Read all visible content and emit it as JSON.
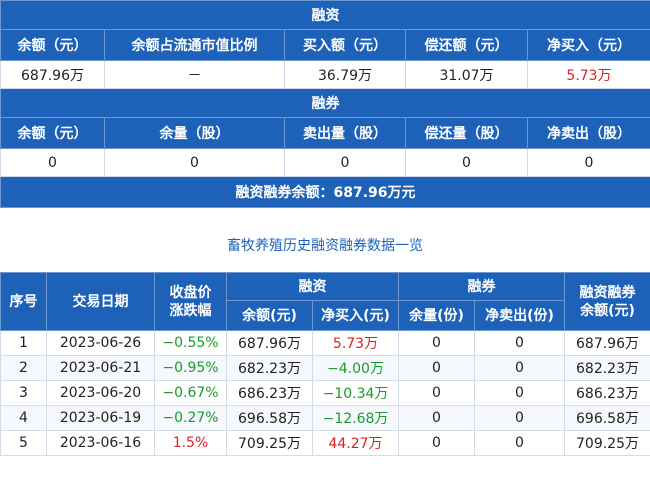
{
  "financing": {
    "section_title": "融资",
    "headers": [
      "余额（元）",
      "余额占流通市值比例",
      "买入额（元）",
      "偿还额（元）",
      "净买入（元）"
    ],
    "values": [
      "687.96万",
      "－",
      "36.79万",
      "31.07万",
      "5.73万"
    ]
  },
  "securities_lending": {
    "section_title": "融券",
    "headers": [
      "余额（元）",
      "余量（股）",
      "卖出量（股）",
      "偿还量（股）",
      "净卖出（股）"
    ],
    "values": [
      "0",
      "0",
      "0",
      "0",
      "0"
    ]
  },
  "total": {
    "label": "融资融券余额：687.96万元"
  },
  "history": {
    "caption": "畜牧养殖历史融资融券数据一览",
    "headers": {
      "index": "序号",
      "date": "交易日期",
      "change": "收盘价涨跌幅",
      "financing_group": "融资",
      "securities_group": "融券",
      "total": "融资融券余额(元)",
      "fin_balance": "余额(元)",
      "fin_net_buy": "净买入(元)",
      "sec_volume": "余量(份)",
      "sec_net_sell": "净卖出(份)"
    },
    "rows": [
      {
        "index": "1",
        "date": "2023-06-26",
        "change": "−0.55%",
        "fin_balance": "687.96万",
        "fin_net_buy": "5.73万",
        "sec_volume": "0",
        "sec_net_sell": "0",
        "total": "687.96万"
      },
      {
        "index": "2",
        "date": "2023-06-21",
        "change": "−0.95%",
        "fin_balance": "682.23万",
        "fin_net_buy": "−4.00万",
        "sec_volume": "0",
        "sec_net_sell": "0",
        "total": "682.23万"
      },
      {
        "index": "3",
        "date": "2023-06-20",
        "change": "−0.67%",
        "fin_balance": "686.23万",
        "fin_net_buy": "−10.34万",
        "sec_volume": "0",
        "sec_net_sell": "0",
        "total": "686.23万"
      },
      {
        "index": "4",
        "date": "2023-06-19",
        "change": "−0.27%",
        "fin_balance": "696.58万",
        "fin_net_buy": "−12.68万",
        "sec_volume": "0",
        "sec_net_sell": "0",
        "total": "696.58万"
      },
      {
        "index": "5",
        "date": "2023-06-16",
        "change": "1.5%",
        "fin_balance": "709.25万",
        "fin_net_buy": "44.27万",
        "sec_volume": "0",
        "sec_net_sell": "0",
        "total": "709.25万"
      }
    ]
  },
  "colors": {
    "header_blue": "#1d62b8",
    "positive_red": "#e02020",
    "negative_green": "#1b9a2e"
  }
}
